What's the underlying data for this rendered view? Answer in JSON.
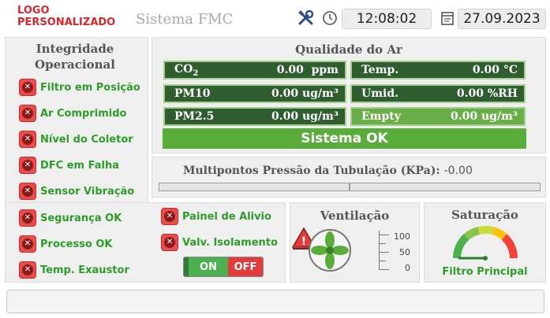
{
  "header": {
    "logo": "LOGO PERSONALIZADO",
    "title": "Sistema FMC",
    "time": "12:08:02",
    "date": "27.09.2023",
    "tools_icon": "tools-icon",
    "clock_icon": "clock-icon",
    "calendar_icon": "calendar-icon"
  },
  "integridade": {
    "title": "Integridade Operacional",
    "items": [
      "Filtro em Posição",
      "Ar Comprimido",
      "Nível do Coletor",
      "DFC em Falha",
      "Sensor Vibração"
    ]
  },
  "seguranca": {
    "left": [
      "Segurança OK",
      "Processo OK",
      "Temp. Exaustor"
    ],
    "right": [
      "Painel de Alivio",
      "Valv. Isolamento"
    ],
    "toggle_on": "ON",
    "toggle_off": "OFF"
  },
  "qualidade": {
    "title": "Qualidade  do Ar",
    "sensors": [
      {
        "name": "CO2",
        "value": "0.00",
        "unit": "ppm"
      },
      {
        "name": "Temp.",
        "value": "0.00",
        "unit": "°C"
      },
      {
        "name": "PM10",
        "value": "0.00",
        "unit": "ug/m³"
      },
      {
        "name": "Umid.",
        "value": "0.00",
        "unit": "%RH"
      },
      {
        "name": "PM2.5",
        "value": "0.00",
        "unit": "ug/m³"
      },
      {
        "name": "Empty",
        "value": "0.00",
        "unit": "ug/m³"
      }
    ],
    "status": "Sistema OK"
  },
  "pressao": {
    "label": "Multipontos Pressão da Tubulação (KPa):",
    "value": "-0.00"
  },
  "ventilacao": {
    "title": "Ventilação",
    "scale": [
      "100",
      "50",
      "0"
    ]
  },
  "saturacao": {
    "title": "Saturação",
    "label": "Filtro Principal"
  },
  "colors": {
    "status_green": "#2f9c2a",
    "alarm_red": "#e84d4d",
    "sensor_dark": "#2f5d2f",
    "sensor_light": "#6aae4a",
    "ok_green": "#5aad3a"
  }
}
